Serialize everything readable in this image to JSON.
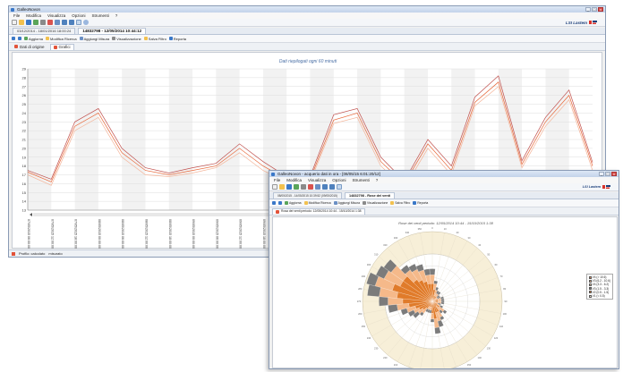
{
  "win1": {
    "title": "GalleoNovon",
    "menu": [
      "File",
      "Modifica",
      "Visualizza",
      "Opzioni",
      "Strumenti",
      "?"
    ],
    "brand": "LSI Lastem",
    "doc_tab": {
      "inactive": "03/12/2014 - 18/01/2016 18:00:24",
      "active": "14832798 - 12/05/2014 10:44:12"
    },
    "nav": {
      "update": "Aggiorna",
      "edit_range": "Modifica Ricerca",
      "add_measure": "Aggiungi Misura",
      "view": "Visualizzazione",
      "filter": "Salva Filtro",
      "report": "Reporta"
    },
    "sub_tabs": [
      "Dati di origine",
      "Grafici"
    ],
    "chart_title": "Dati riepilogati ogni 60 minuti",
    "status": [
      "Profilo: calcolato",
      "misurato"
    ]
  },
  "win2": {
    "title": "GalleoNovon - acquerio dati in ora - [08/05/15 6:01:20/12]",
    "menu": [
      "File",
      "Modifica",
      "Visualizza",
      "Opzioni",
      "Strumenti",
      "?"
    ],
    "brand": "LSI Lastem",
    "doc_tab": {
      "inactive": "08/05/2015 - 14/05/2015 10:39:52 (09/05/2015)",
      "active": "14832798 - Rose dei venti"
    },
    "nav": {
      "update": "Aggiorna",
      "edit_range": "Modifica Ricerca",
      "add_measure": "Aggiungi Misura",
      "view": "Visualizzazione",
      "filter": "Salva Filtro",
      "report": "Reporta"
    },
    "sub_tabs": [
      "Rosa dei venti periodo: 12/05/2014 10:44 - 15/10/2014 1:38"
    ],
    "chart_title": "Rose dei venti periodo: 12/05/2014 10:44 - 15/10/2015 1:38",
    "legend": [
      "V4 (> 10.6)",
      "V3 (6.2 - 10.6)",
      "V4 (3.3 - 6.2)",
      "V3 (1.5 - 3.3)",
      "V2 (0.5 - 1.5)",
      "V1 (< 0.5)"
    ]
  },
  "colors": {
    "series1": "#e8683a",
    "series2": "#f4b59a",
    "series3": "#c0504d",
    "rose1": "#e07b2a",
    "rose2": "#f5b98a",
    "rose3": "#7b7b7b",
    "rose4": "#f7d6b0",
    "accent": "#3a78c8"
  },
  "chart_data": [
    {
      "type": "line",
      "title": "Dati riepilogati ogni 60 minuti",
      "x": [
        "07/05/2015 06:00:00",
        "07/05/2015 12:00:00",
        "07/05/2015 18:00:00",
        "08/05/2015 00:00:00",
        "08/05/2015 06:00:00",
        "08/05/2015 12:00:00",
        "08/05/2015 18:00:00",
        "09/05/2015 00:00:00",
        "09/05/2015 06:00:00",
        "09/05/2015 12:00:00",
        "09/05/2015 18:00:00",
        "10/05/2015 00:00:00",
        "10/05/2015 06:00:00",
        "10/05/2015 12:00:00",
        "10/05/2015 18:00:00",
        "11/05/2015 00:00:00",
        "11/05/2015 06:00:00",
        "11/05/2015 12:00:00",
        "11/05/2015 18:00:00",
        "12/05/2015 00:00:00",
        "12/05/2015 06:00:00",
        "12/05/2015 12:00:00",
        "12/05/2015 18:00:00",
        "13/05/2015 00:00:00",
        "13/05/2015 06:00:00"
      ],
      "ylim": [
        13,
        29
      ],
      "yticks": [
        13,
        14,
        15,
        16,
        17,
        18,
        19,
        20,
        21,
        22,
        23,
        24,
        25,
        26,
        27,
        28,
        29
      ],
      "series": [
        {
          "values": [
            17.3,
            16.2,
            22.5,
            24.0,
            19.5,
            17.5,
            17.0,
            17.5,
            18.0,
            20.0,
            18.0,
            16.5,
            16.5,
            23.2,
            24.0,
            18.5,
            16.0,
            20.5,
            17.5,
            25.2,
            27.5,
            18.2,
            23.0,
            26.0,
            18.0
          ]
        },
        {
          "values": [
            17.0,
            15.8,
            22.0,
            23.5,
            19.0,
            17.0,
            16.8,
            17.2,
            17.8,
            19.5,
            17.5,
            16.2,
            16.2,
            22.8,
            23.5,
            18.0,
            15.5,
            20.0,
            17.0,
            24.8,
            27.0,
            17.8,
            22.5,
            25.5,
            17.5
          ]
        },
        {
          "values": [
            17.5,
            16.5,
            23.0,
            24.5,
            20.0,
            17.8,
            17.2,
            17.8,
            18.3,
            20.5,
            18.5,
            16.8,
            16.8,
            23.8,
            24.5,
            19.0,
            16.3,
            21.0,
            18.0,
            25.8,
            28.2,
            18.6,
            23.5,
            26.6,
            18.4
          ]
        }
      ]
    },
    {
      "type": "rose",
      "title": "Rose dei venti periodo: 12/05/2014 10:44 - 15/10/2015 1:38",
      "directions": 36,
      "radial_ticks": [
        2,
        4,
        6,
        8
      ],
      "series": [
        {
          "name": "V4 (> 10.6)",
          "values": [
            0,
            0,
            0,
            0,
            0,
            0,
            0,
            0,
            0,
            0,
            0,
            0,
            0,
            0,
            0,
            0,
            0,
            0,
            0,
            0,
            0,
            0,
            0,
            0,
            0,
            0,
            0,
            0,
            0,
            0,
            0,
            0,
            0,
            0,
            0,
            0
          ]
        },
        {
          "name": "V3 (6.2 - 10.6)",
          "values": [
            3,
            2,
            1,
            1,
            1,
            0.5,
            0.5,
            1,
            1,
            1,
            1,
            0.5,
            1,
            1.5,
            1,
            2,
            2,
            3,
            2,
            1,
            1,
            1,
            1.5,
            2,
            2.5,
            3,
            4,
            5,
            6,
            7,
            6,
            6,
            4.5,
            4,
            3.5,
            3
          ]
        },
        {
          "name": "V4 (3.3 - 6.2)",
          "values": [
            1.5,
            1,
            1,
            0.5,
            0.5,
            0.5,
            0.5,
            0.5,
            0.5,
            0.5,
            0.5,
            0.5,
            0.5,
            1,
            1,
            1,
            1.5,
            1.5,
            1,
            0.5,
            0.5,
            0.5,
            1,
            1,
            1,
            1.5,
            2,
            2.5,
            3,
            3,
            3,
            2.5,
            2,
            2,
            2,
            1.5
          ]
        },
        {
          "name": "V3 (1.5 - 3.3)",
          "values": [
            1,
            0.5,
            0.5,
            0.5,
            0.5,
            0.5,
            0.5,
            0.5,
            0.5,
            0.5,
            0.5,
            0.5,
            0.5,
            0.5,
            0.5,
            0.5,
            1,
            1,
            0.5,
            0.5,
            0.5,
            0.5,
            0.5,
            1,
            1,
            1,
            1.5,
            1.5,
            2,
            1.5,
            1.5,
            1.5,
            1,
            1,
            1,
            1
          ]
        }
      ]
    }
  ]
}
